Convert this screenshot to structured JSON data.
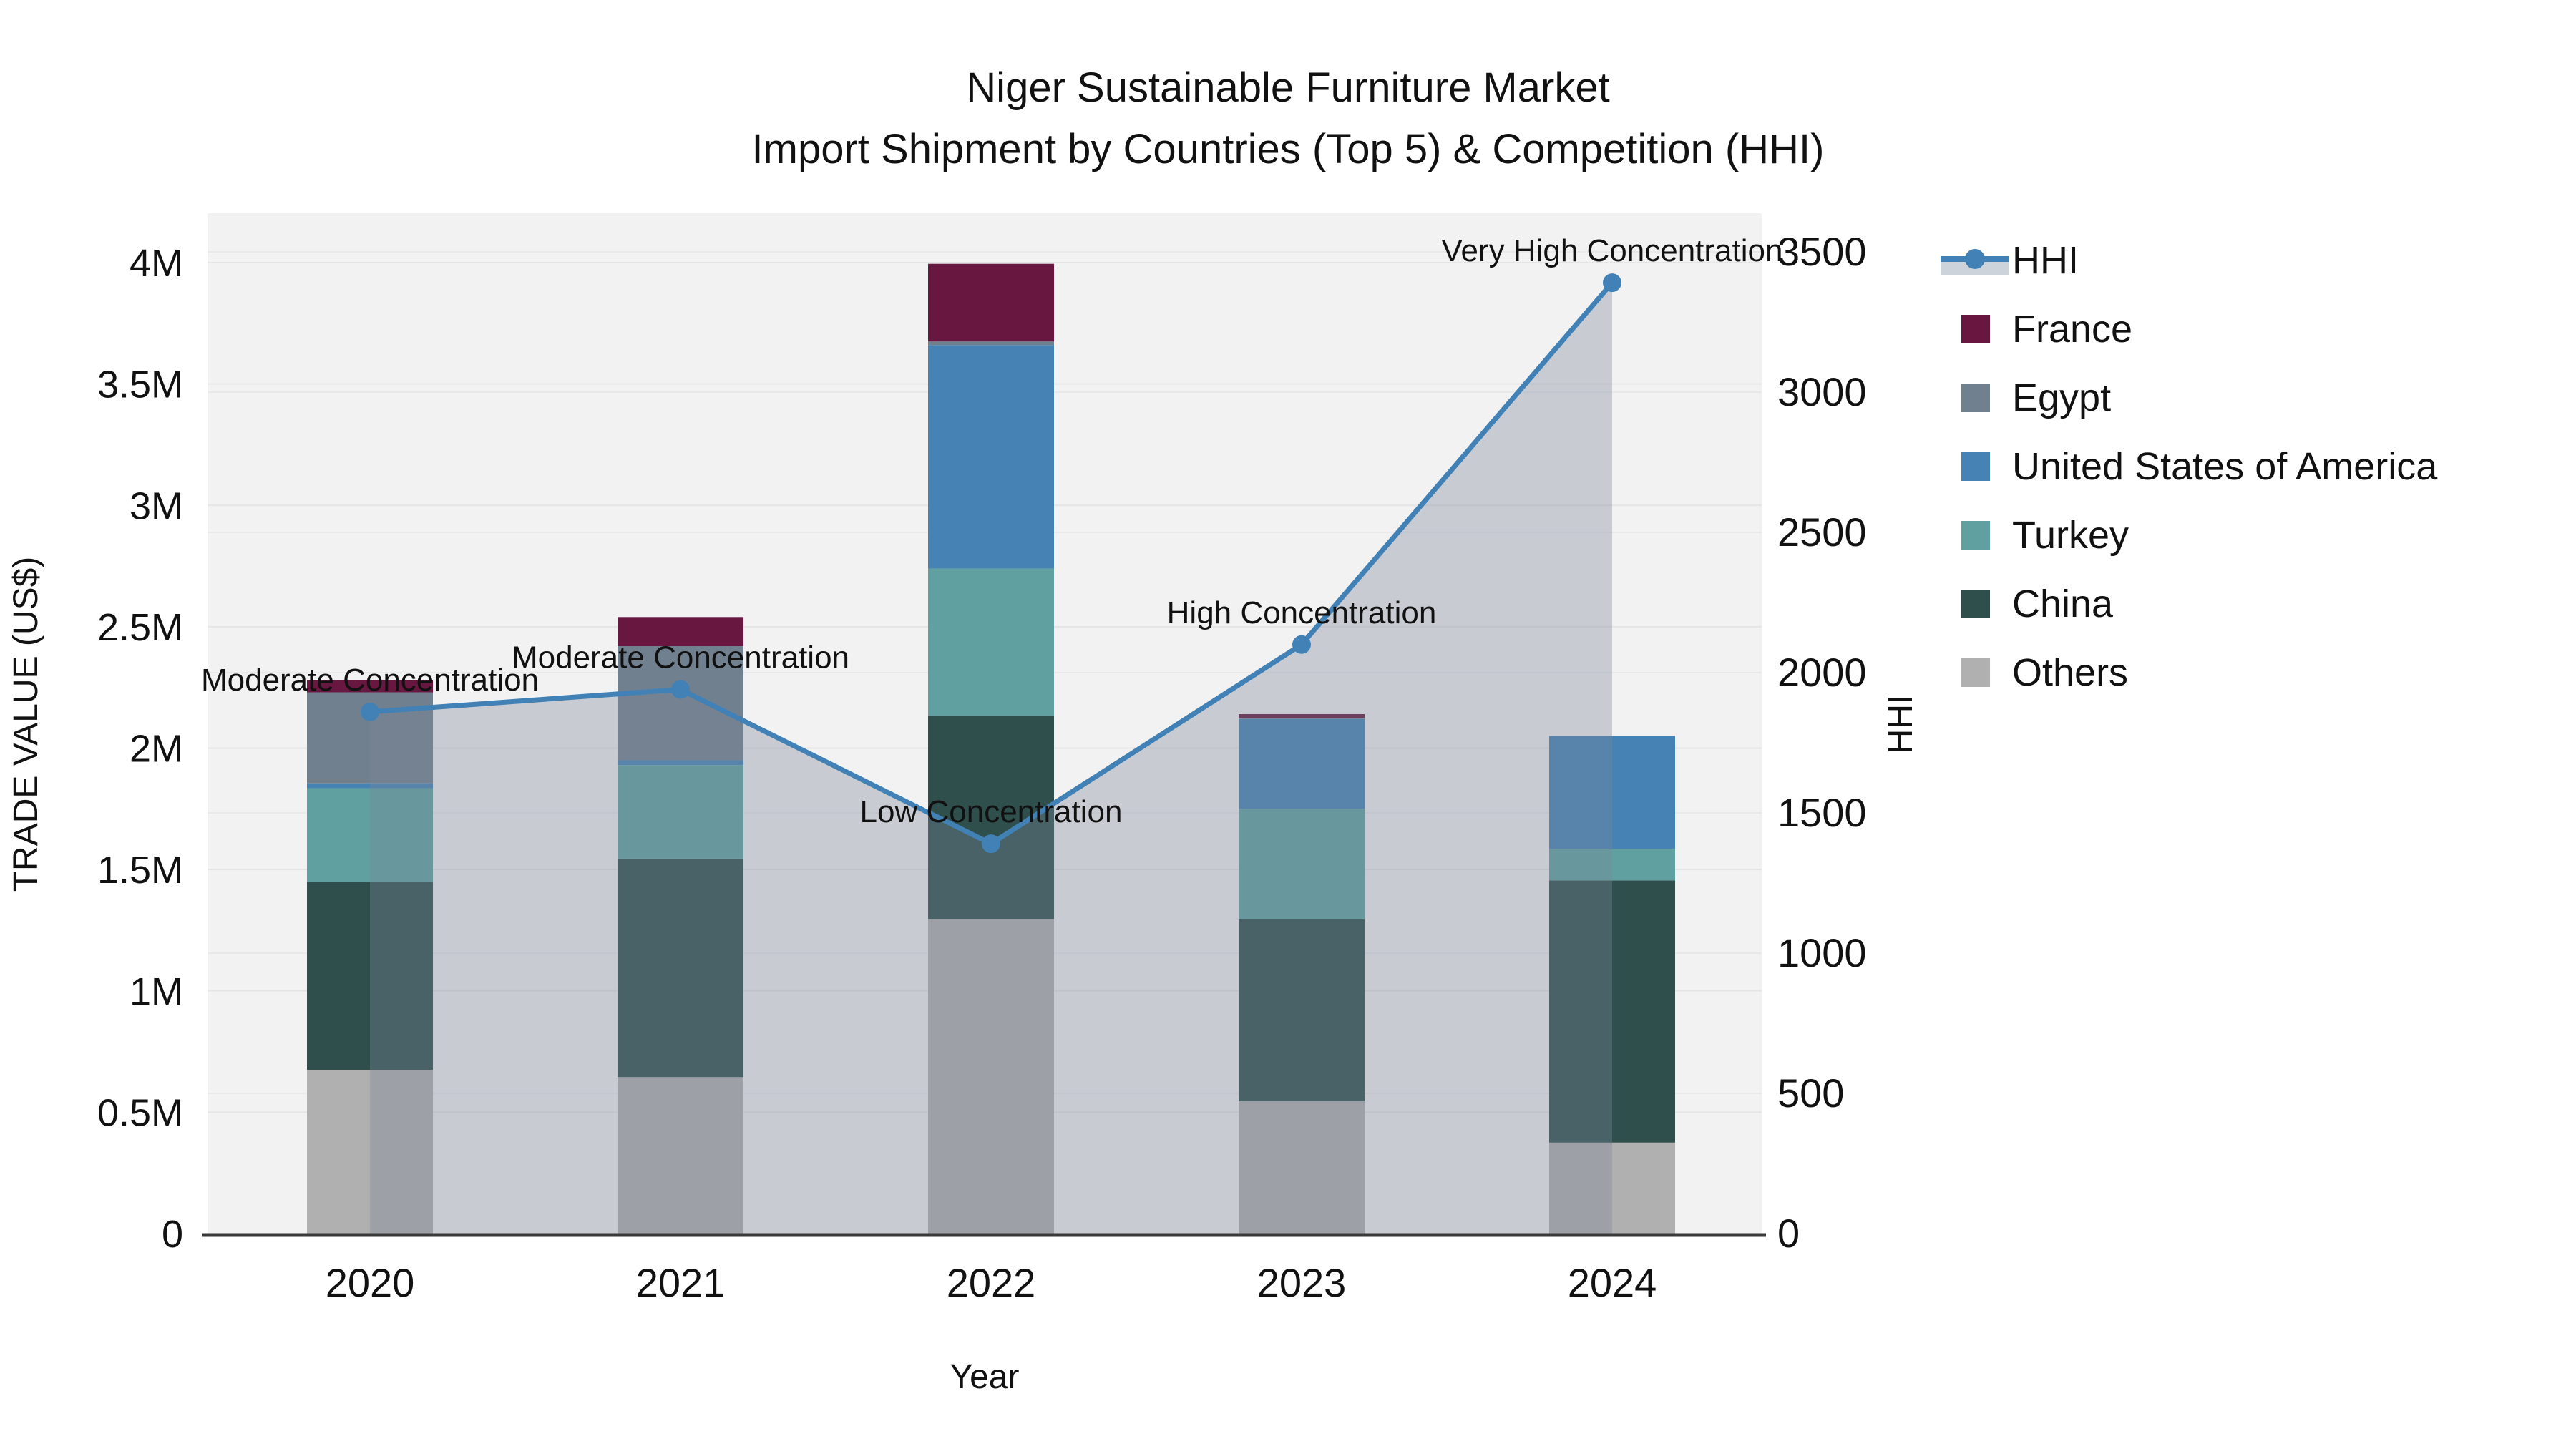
{
  "title": {
    "line1": "Niger Sustainable Furniture Market",
    "line2": "Import Shipment by Countries (Top 5) & Competition (HHI)"
  },
  "colors": {
    "plot_background": "#F2F2F2",
    "grid_left": "#E5E5E5",
    "grid_right": "#E9E9EB",
    "axis_line": "#3A3A3A",
    "hhi_line": "#4181B5",
    "hhi_area_fill": "rgba(122,136,152,0.35)",
    "hhi_legend_band": "#CDD3DB",
    "text": "#111111"
  },
  "chart_data": {
    "type": "bar",
    "subtype": "stacked-bars-with-line-overlay",
    "categories": [
      "2020",
      "2021",
      "2022",
      "2023",
      "2024"
    ],
    "value_unit": "millions of US$",
    "stack_order_bottom_up": [
      "Others",
      "China",
      "Turkey",
      "United States of America",
      "Egypt",
      "France"
    ],
    "series": [
      {
        "name": "Others",
        "color": "#B0B0B0",
        "values": [
          0.675,
          0.645,
          1.295,
          0.545,
          0.375
        ]
      },
      {
        "name": "China",
        "color": "#2F4F4D",
        "values": [
          0.775,
          0.9,
          0.84,
          0.75,
          1.08
        ]
      },
      {
        "name": "Turkey",
        "color": "#60A0A1",
        "values": [
          0.385,
          0.385,
          0.605,
          0.455,
          0.13
        ]
      },
      {
        "name": "United States of America",
        "color": "#4682B4",
        "values": [
          0.02,
          0.02,
          0.92,
          0.37,
          0.465
        ]
      },
      {
        "name": "Egypt",
        "color": "#71808F",
        "values": [
          0.375,
          0.47,
          0.015,
          0.005,
          0.0
        ]
      },
      {
        "name": "France",
        "color": "#671740",
        "values": [
          0.05,
          0.12,
          0.32,
          0.015,
          0.0
        ]
      }
    ],
    "line": {
      "name": "HHI",
      "values": [
        1860,
        1940,
        1390,
        2100,
        3390
      ]
    },
    "annotations": [
      "Moderate Concentration",
      "Moderate Concentration",
      "Low Concentration",
      "High Concentration",
      "Very High Concentration"
    ],
    "left_axis": {
      "label": "TRADE VALUE (US$)",
      "ticks": [
        "0",
        "0.5M",
        "1M",
        "1.5M",
        "2M",
        "2.5M",
        "3M",
        "3.5M",
        "4M"
      ],
      "tick_values": [
        0,
        0.5,
        1,
        1.5,
        2,
        2.5,
        3,
        3.5,
        4
      ],
      "range": [
        0,
        4
      ]
    },
    "right_axis": {
      "label": "HHI",
      "ticks": [
        "0",
        "500",
        "1000",
        "1500",
        "2000",
        "2500",
        "3000",
        "3500"
      ],
      "tick_values": [
        0,
        500,
        1000,
        1500,
        2000,
        2500,
        3000,
        3500
      ],
      "range": [
        0,
        3500
      ]
    },
    "x_axis": {
      "label": "Year"
    },
    "legend_position": "right"
  },
  "legend": {
    "items": [
      {
        "label": "HHI",
        "type": "line"
      },
      {
        "label": "France",
        "type": "swatch",
        "color": "#671740"
      },
      {
        "label": "Egypt",
        "type": "swatch",
        "color": "#71808F"
      },
      {
        "label": "United States of America",
        "type": "swatch",
        "color": "#4682B4"
      },
      {
        "label": "Turkey",
        "type": "swatch",
        "color": "#60A0A1"
      },
      {
        "label": "China",
        "type": "swatch",
        "color": "#2F4F4D"
      },
      {
        "label": "Others",
        "type": "swatch",
        "color": "#B0B0B0"
      }
    ]
  }
}
